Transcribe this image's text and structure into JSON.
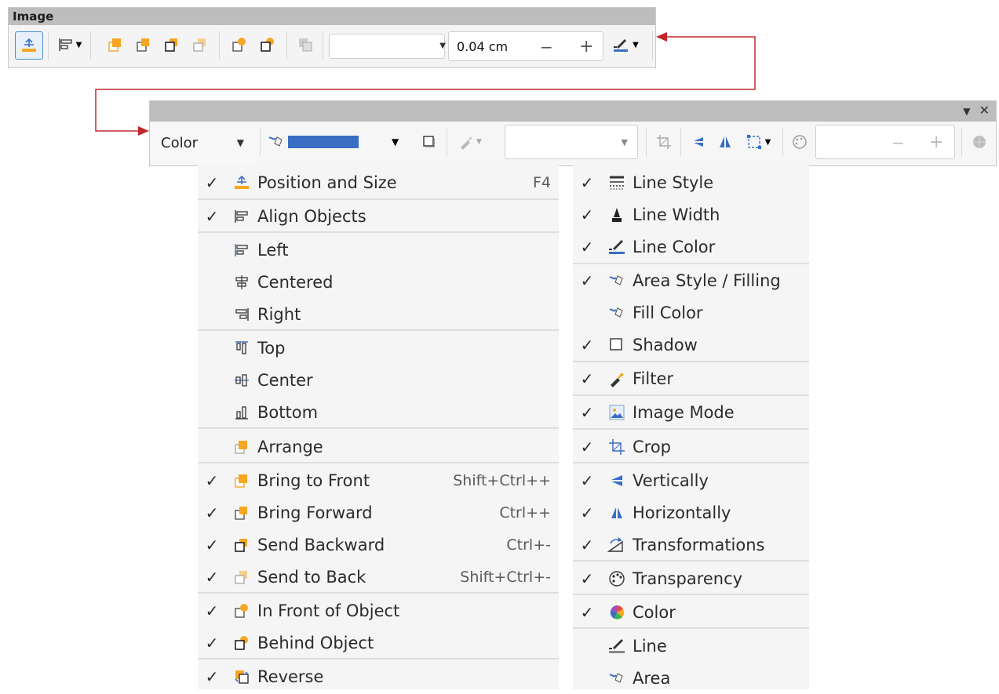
{
  "toolbar_image": {
    "title": "Image",
    "line_width_value": "0.04 cm",
    "minus": "−",
    "plus": "+"
  },
  "toolbar_lower": {
    "area_style": "Color",
    "minus": "−",
    "plus": "+",
    "fill_color": "#3a6ec3"
  },
  "menu_left": [
    {
      "checked": true,
      "icon": "position-size-icon",
      "label": "Position and Size",
      "shortcut": "F4"
    },
    {
      "checked": true,
      "icon": "align-objects-icon",
      "label": "Align Objects",
      "shortcut": ""
    },
    {
      "checked": false,
      "icon": "align-left-icon",
      "label": "Left",
      "shortcut": ""
    },
    {
      "checked": false,
      "icon": "align-centered-icon",
      "label": "Centered",
      "shortcut": ""
    },
    {
      "checked": false,
      "icon": "align-right-icon",
      "label": "Right",
      "shortcut": ""
    },
    {
      "checked": false,
      "icon": "align-top-icon",
      "label": "Top",
      "shortcut": ""
    },
    {
      "checked": false,
      "icon": "align-center-icon",
      "label": "Center",
      "shortcut": ""
    },
    {
      "checked": false,
      "icon": "align-bottom-icon",
      "label": "Bottom",
      "shortcut": ""
    },
    {
      "checked": false,
      "icon": "arrange-icon",
      "label": "Arrange",
      "shortcut": ""
    },
    {
      "checked": true,
      "icon": "bring-to-front-icon",
      "label": "Bring to Front",
      "shortcut": "Shift+Ctrl++"
    },
    {
      "checked": true,
      "icon": "bring-forward-icon",
      "label": "Bring Forward",
      "shortcut": "Ctrl++"
    },
    {
      "checked": true,
      "icon": "send-backward-icon",
      "label": "Send Backward",
      "shortcut": "Ctrl+-"
    },
    {
      "checked": true,
      "icon": "send-to-back-icon",
      "label": "Send to Back",
      "shortcut": "Shift+Ctrl+-"
    },
    {
      "checked": true,
      "icon": "in-front-of-object-icon",
      "label": "In Front of Object",
      "shortcut": ""
    },
    {
      "checked": true,
      "icon": "behind-object-icon",
      "label": "Behind Object",
      "shortcut": ""
    },
    {
      "checked": true,
      "icon": "reverse-icon",
      "label": "Reverse",
      "shortcut": ""
    }
  ],
  "menu_right": [
    {
      "checked": true,
      "icon": "line-style-icon",
      "label": "Line Style"
    },
    {
      "checked": true,
      "icon": "line-width-icon",
      "label": "Line Width"
    },
    {
      "checked": true,
      "icon": "line-color-icon",
      "label": "Line Color"
    },
    {
      "checked": true,
      "icon": "area-style-icon",
      "label": "Area Style / Filling"
    },
    {
      "checked": false,
      "icon": "fill-color-icon",
      "label": "Fill Color"
    },
    {
      "checked": true,
      "icon": "shadow-icon",
      "label": "Shadow"
    },
    {
      "checked": true,
      "icon": "filter-icon",
      "label": "Filter"
    },
    {
      "checked": true,
      "icon": "image-mode-icon",
      "label": "Image Mode"
    },
    {
      "checked": true,
      "icon": "crop-icon",
      "label": "Crop"
    },
    {
      "checked": true,
      "icon": "flip-vertically-icon",
      "label": "Vertically"
    },
    {
      "checked": true,
      "icon": "flip-horizontally-icon",
      "label": "Horizontally"
    },
    {
      "checked": true,
      "icon": "transformations-icon",
      "label": "Transformations"
    },
    {
      "checked": true,
      "icon": "transparency-icon",
      "label": "Transparency"
    },
    {
      "checked": true,
      "icon": "color-icon",
      "label": "Color"
    },
    {
      "checked": false,
      "icon": "line-icon",
      "label": "Line"
    },
    {
      "checked": false,
      "icon": "area-icon",
      "label": "Area"
    }
  ],
  "colors": {
    "callout_arrow": "#c0282d",
    "accent_orange": "#f5a623",
    "accent_blue": "#3a6ec3"
  }
}
